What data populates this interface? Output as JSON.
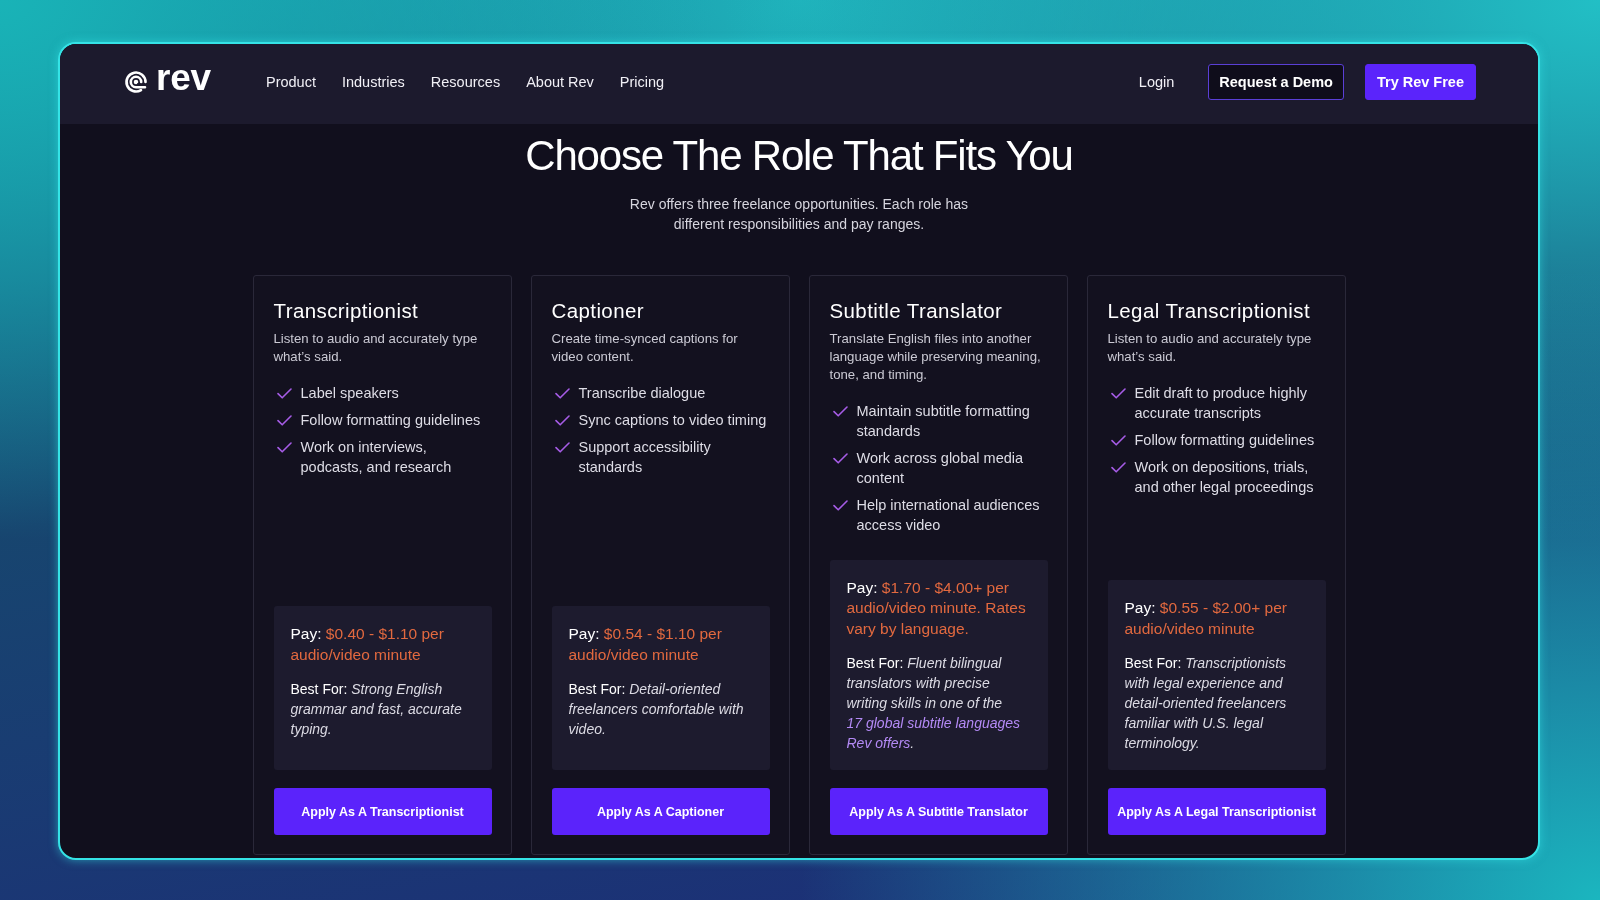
{
  "nav": {
    "logo": "rev",
    "links": [
      "Product",
      "Industries",
      "Resources",
      "About Rev",
      "Pricing"
    ],
    "login": "Login",
    "buttons": [
      {
        "label": "Request a Demo",
        "kind": "outline"
      },
      {
        "label": "Try Rev Free",
        "kind": "primary"
      }
    ]
  },
  "hero": {
    "title": "Choose The Role That Fits You",
    "subtitle": "Rev offers three freelance opportunities. Each role has different responsibilities and pay ranges."
  },
  "roles": [
    {
      "title": "Transcriptionist",
      "description": "Listen to audio and accurately type what’s said.",
      "features": [
        "Label speakers",
        "Follow formatting guidelines",
        "Work on interviews, podcasts, and research"
      ],
      "pay_label": "Pay:",
      "pay": "$0.40 - $1.10 per audio/video minute",
      "best_for_label": "Best For:",
      "best_for": [
        {
          "kind": "text",
          "text": "Strong English grammar and fast, accurate typing."
        }
      ],
      "button": "Apply As A Transcriptionist"
    },
    {
      "title": "Captioner",
      "description": "Create time-synced captions for video content.",
      "features": [
        "Transcribe dialogue",
        "Sync captions to video timing",
        "Support accessibility standards"
      ],
      "pay_label": "Pay:",
      "pay": "$0.54 - $1.10 per audio/video minute",
      "best_for_label": "Best For:",
      "best_for": [
        {
          "kind": "text",
          "text": "Detail-oriented freelancers comfortable with video."
        }
      ],
      "button": "Apply As A Captioner"
    },
    {
      "title": "Subtitle Translator",
      "description": "Translate English files into another language while preserving meaning, tone, and timing.",
      "features": [
        "Maintain subtitle formatting standards",
        "Work across global media content",
        "Help international audiences access video"
      ],
      "pay_label": "Pay:",
      "pay": "$1.70 - $4.00+ per audio/video minute. Rates vary by language.",
      "best_for_label": "Best For:",
      "best_for": [
        {
          "kind": "text",
          "text": "Fluent bilingual translators with precise writing skills in one of the "
        },
        {
          "kind": "link",
          "text": "17 global subtitle languages Rev offers"
        },
        {
          "kind": "text",
          "text": "."
        }
      ],
      "button": "Apply As A Subtitle Translator"
    },
    {
      "title": "Legal Transcriptionist",
      "description": "Listen to audio and accurately type what’s said.",
      "features": [
        "Edit draft to produce highly accurate transcripts",
        "Follow formatting guidelines",
        "Work on depositions, trials, and other legal proceedings"
      ],
      "pay_label": "Pay:",
      "pay": "$0.55 - $2.00+ per audio/video minute",
      "best_for_label": "Best For:",
      "best_for": [
        {
          "kind": "text",
          "text": "Transcriptionists with legal experience and detail-oriented freelancers familiar with U.S. legal terminology."
        }
      ],
      "button": "Apply As A Legal Transcriptionist"
    }
  ]
}
